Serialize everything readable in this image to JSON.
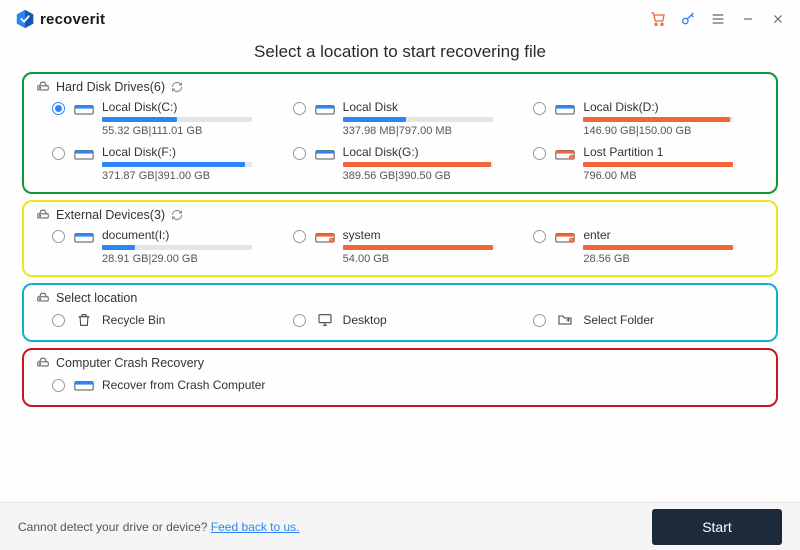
{
  "brand": {
    "name": "recoverit"
  },
  "heading": "Select a location to start recovering file",
  "sections": {
    "hdd": {
      "title": "Hard Disk Drives(6)"
    },
    "ext": {
      "title": "External Devices(3)"
    },
    "loc": {
      "title": "Select location"
    },
    "crash": {
      "title": "Computer Crash Recovery"
    }
  },
  "drives": {
    "hdd": [
      {
        "name": "Local Disk(C:)",
        "usage": "55.32  GB|111.01  GB",
        "pct": 50,
        "fill": "blue",
        "warn": false,
        "selected": true
      },
      {
        "name": "Local Disk",
        "usage": "337.98  MB|797.00  MB",
        "pct": 42,
        "fill": "blue",
        "warn": false,
        "selected": false
      },
      {
        "name": "Local Disk(D:)",
        "usage": "146.90  GB|150.00  GB",
        "pct": 98,
        "fill": "orange",
        "warn": false,
        "selected": false
      },
      {
        "name": "Local Disk(F:)",
        "usage": "371.87  GB|391.00  GB",
        "pct": 95,
        "fill": "blue",
        "warn": false,
        "selected": false
      },
      {
        "name": "Local Disk(G:)",
        "usage": "389.56  GB|390.50  GB",
        "pct": 99,
        "fill": "orange",
        "warn": false,
        "selected": false
      },
      {
        "name": "Lost Partition 1",
        "usage": "796.00  MB",
        "pct": 100,
        "fill": "orange",
        "warn": true,
        "selected": false
      }
    ],
    "ext": [
      {
        "name": "document(I:)",
        "usage": "28.91  GB|29.00  GB",
        "pct": 22,
        "fill": "blue",
        "warn": false,
        "selected": false
      },
      {
        "name": "system",
        "usage": "54.00  GB",
        "pct": 100,
        "fill": "orange",
        "warn": true,
        "selected": false
      },
      {
        "name": "enter",
        "usage": "28.56  GB",
        "pct": 100,
        "fill": "orange",
        "warn": true,
        "selected": false
      }
    ]
  },
  "locations": [
    {
      "name": "Recycle Bin",
      "icon": "trash"
    },
    {
      "name": "Desktop",
      "icon": "desktop"
    },
    {
      "name": "Select Folder",
      "icon": "folder"
    }
  ],
  "crash": {
    "label": "Recover from Crash Computer"
  },
  "footer": {
    "note_prefix": "Cannot detect your drive or device? ",
    "note_link": "Feed back to us.",
    "start": "Start"
  },
  "colors": {
    "accent": "#2b86f5",
    "warn": "#f2643a"
  }
}
